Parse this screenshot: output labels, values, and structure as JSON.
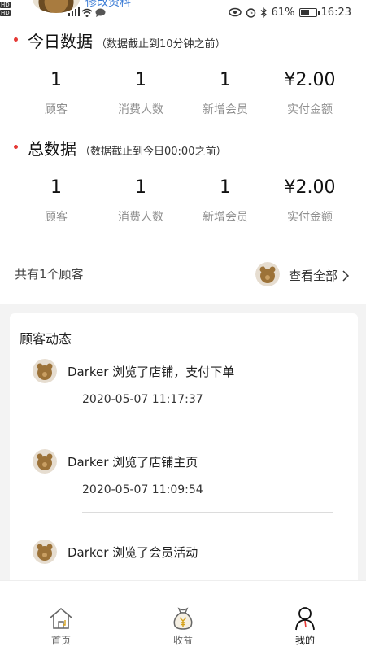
{
  "status_bar": {
    "network_tags": [
      "HD",
      "HD"
    ],
    "signal_label": "4G",
    "battery": "61%",
    "battery_level": 0.61,
    "time": "16:23",
    "edit_link": "修改资料"
  },
  "today": {
    "title": "今日数据",
    "note": "（数据截止到10分钟之前）",
    "stats": [
      {
        "value": "1",
        "label": "顾客"
      },
      {
        "value": "1",
        "label": "消费人数"
      },
      {
        "value": "1",
        "label": "新增会员"
      },
      {
        "value": "¥2.00",
        "label": "实付金额"
      }
    ]
  },
  "total": {
    "title": "总数据",
    "note": "（数据截止到今日00:00之前）",
    "stats": [
      {
        "value": "1",
        "label": "顾客"
      },
      {
        "value": "1",
        "label": "消费人数"
      },
      {
        "value": "1",
        "label": "新增会员"
      },
      {
        "value": "¥2.00",
        "label": "实付金额"
      }
    ]
  },
  "customers": {
    "count_text": "共有1个顾客",
    "view_all": "查看全部"
  },
  "activity": {
    "title": "顾客动态",
    "items": [
      {
        "text": "Darker 浏览了店铺，支付下单",
        "time": "2020-05-07 11:17:37"
      },
      {
        "text": "Darker 浏览了店铺主页",
        "time": "2020-05-07 11:09:54"
      },
      {
        "text": "Darker 浏览了会员活动",
        "time": ""
      }
    ]
  },
  "tabs": [
    {
      "label": "首页",
      "icon": "home-icon"
    },
    {
      "label": "收益",
      "icon": "money-bag-icon"
    },
    {
      "label": "我的",
      "icon": "person-icon",
      "active": true
    }
  ],
  "colors": {
    "accent_dot": "#e53935",
    "label_gray": "#8e8e8e",
    "background_gray": "#f3f3f3"
  }
}
